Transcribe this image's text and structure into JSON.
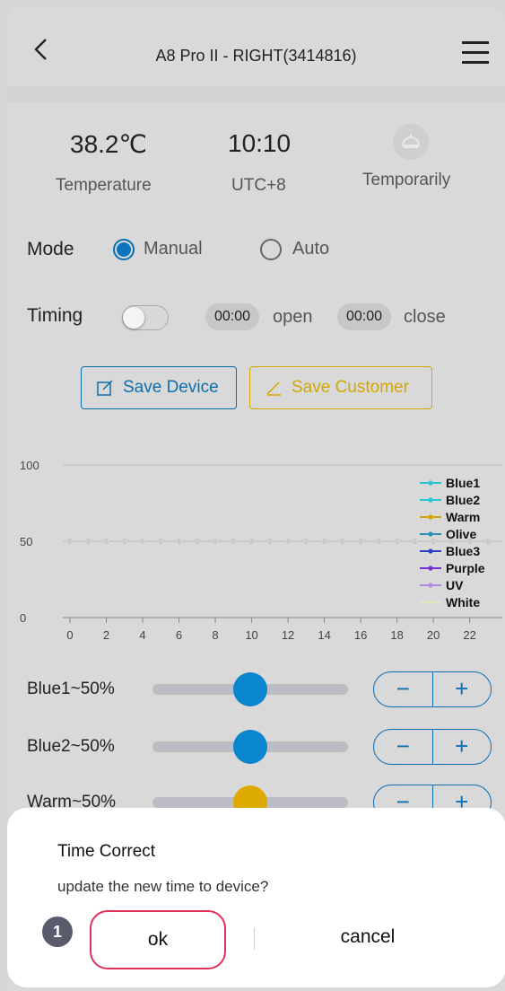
{
  "header": {
    "title": "A8 Pro II - RIGHT(3414816)"
  },
  "status": {
    "temperature_value": "38.2℃",
    "temperature_label": "Temperature",
    "time_value": "10:10",
    "timezone_label": "UTC+8",
    "lamp_label": "Temporarily"
  },
  "mode": {
    "label": "Mode",
    "options": [
      "Manual",
      "Auto"
    ],
    "selected": "Manual"
  },
  "timing": {
    "label": "Timing",
    "enabled": false,
    "open_time": "00:00",
    "open_label": "open",
    "close_time": "00:00",
    "close_label": "close"
  },
  "buttons": {
    "save_device": "Save Device",
    "save_customer": "Save Customer"
  },
  "chart_data": {
    "type": "line",
    "x": [
      0,
      1,
      2,
      3,
      4,
      5,
      6,
      7,
      8,
      9,
      10,
      11,
      12,
      13,
      14,
      15,
      16,
      17,
      18,
      19,
      20,
      21,
      22,
      23
    ],
    "xticks": [
      "0",
      "2",
      "4",
      "6",
      "8",
      "10",
      "12",
      "14",
      "16",
      "18",
      "20",
      "22"
    ],
    "yticks": [
      "0",
      "50",
      "100"
    ],
    "ylim": [
      0,
      100
    ],
    "series": [
      {
        "name": "Blue1",
        "color": "#2cc4d4",
        "values": [
          50,
          50,
          50,
          50,
          50,
          50,
          50,
          50,
          50,
          50,
          50,
          50,
          50,
          50,
          50,
          50,
          50,
          50,
          50,
          50,
          50,
          50,
          50,
          50
        ]
      },
      {
        "name": "Blue2",
        "color": "#22c9d0",
        "values": [
          50,
          50,
          50,
          50,
          50,
          50,
          50,
          50,
          50,
          50,
          50,
          50,
          50,
          50,
          50,
          50,
          50,
          50,
          50,
          50,
          50,
          50,
          50,
          50
        ]
      },
      {
        "name": "Warm",
        "color": "#d4a400",
        "values": [
          50,
          50,
          50,
          50,
          50,
          50,
          50,
          50,
          50,
          50,
          50,
          50,
          50,
          50,
          50,
          50,
          50,
          50,
          50,
          50,
          50,
          50,
          50,
          50
        ]
      },
      {
        "name": "Olive",
        "color": "#2a8fb0",
        "values": [
          50,
          50,
          50,
          50,
          50,
          50,
          50,
          50,
          50,
          50,
          50,
          50,
          50,
          50,
          50,
          50,
          50,
          50,
          50,
          50,
          50,
          50,
          50,
          50
        ]
      },
      {
        "name": "Blue3",
        "color": "#2b3fc4",
        "values": [
          50,
          50,
          50,
          50,
          50,
          50,
          50,
          50,
          50,
          50,
          50,
          50,
          50,
          50,
          50,
          50,
          50,
          50,
          50,
          50,
          50,
          50,
          50,
          50
        ]
      },
      {
        "name": "Purple",
        "color": "#7a2fd0",
        "values": [
          50,
          50,
          50,
          50,
          50,
          50,
          50,
          50,
          50,
          50,
          50,
          50,
          50,
          50,
          50,
          50,
          50,
          50,
          50,
          50,
          50,
          50,
          50,
          50
        ]
      },
      {
        "name": "UV",
        "color": "#b48ae0",
        "values": [
          50,
          50,
          50,
          50,
          50,
          50,
          50,
          50,
          50,
          50,
          50,
          50,
          50,
          50,
          50,
          50,
          50,
          50,
          50,
          50,
          50,
          50,
          50,
          50
        ]
      },
      {
        "name": "White",
        "color": "#e4e4c4",
        "values": [
          50,
          50,
          50,
          50,
          50,
          50,
          50,
          50,
          50,
          50,
          50,
          50,
          50,
          50,
          50,
          50,
          50,
          50,
          50,
          50,
          50,
          50,
          50,
          50
        ]
      }
    ],
    "legend": "top-right",
    "grid": true
  },
  "channels": [
    {
      "label": "Blue1~50%",
      "value": 50,
      "color": "#0a86cf"
    },
    {
      "label": "Blue2~50%",
      "value": 50,
      "color": "#0a86cf"
    },
    {
      "label": "Warm~50%",
      "value": 50,
      "color": "#dcaa00"
    }
  ],
  "stepper": {
    "minus": "−",
    "plus": "+"
  },
  "dialog": {
    "title": "Time Correct",
    "message": "update the new time to device?",
    "ok": "ok",
    "cancel": "cancel"
  },
  "annotation": {
    "badge": "1"
  }
}
